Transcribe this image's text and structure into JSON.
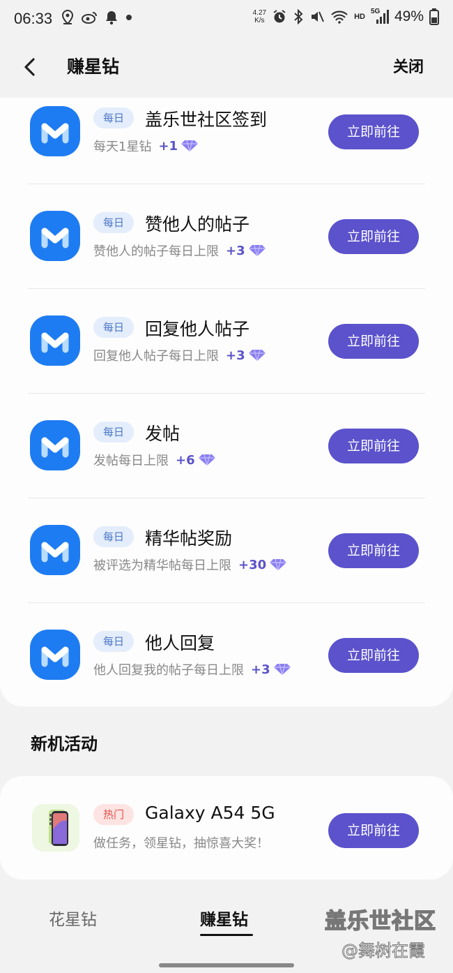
{
  "status_bar": {
    "time": "06:33",
    "net_speed_value": "4.27",
    "net_speed_unit": "K/s",
    "network_label": "HD",
    "signal_label": "5G",
    "battery": "49%",
    "left_icons": [
      "location-icon",
      "weibo-icon",
      "notification-bell-icon",
      "dot-icon"
    ],
    "right_icons": [
      "alarm-icon",
      "bluetooth-icon",
      "mute-icon",
      "wifi-icon",
      "signal-icon",
      "battery-icon"
    ]
  },
  "header": {
    "back_icon": "chevron-left-icon",
    "title": "赚星钻",
    "close_label": "关闭"
  },
  "tasks": [
    {
      "tag": "每日",
      "title": "盖乐世社区签到",
      "desc": "每天1星钻",
      "reward": "+1",
      "button": "立即前往"
    },
    {
      "tag": "每日",
      "title": "赞他人的帖子",
      "desc": "赞他人的帖子每日上限",
      "reward": "+3",
      "button": "立即前往"
    },
    {
      "tag": "每日",
      "title": "回复他人帖子",
      "desc": "回复他人帖子每日上限",
      "reward": "+3",
      "button": "立即前往"
    },
    {
      "tag": "每日",
      "title": "发帖",
      "desc": "发帖每日上限",
      "reward": "+6",
      "button": "立即前往"
    },
    {
      "tag": "每日",
      "title": "精华帖奖励",
      "desc": "被评选为精华帖每日上限",
      "reward": "+30",
      "button": "立即前往"
    },
    {
      "tag": "每日",
      "title": "他人回复",
      "desc": "他人回复我的帖子每日上限",
      "reward": "+3",
      "button": "立即前往"
    }
  ],
  "section": {
    "title": "新机活动"
  },
  "promo": {
    "tag": "热门",
    "title": "Galaxy A54 5G",
    "desc": "做任务，领星钻，抽惊喜大奖！",
    "button": "立即前往"
  },
  "bottom_tabs": {
    "tabs": [
      "花星钻",
      "赚星钻"
    ],
    "active": "赚星钻"
  },
  "watermark": {
    "line1": "盖乐世社区",
    "line2": "@舞树在霞"
  },
  "colors": {
    "accent": "#5b52cc",
    "app_icon_blue": "#1e7cf2",
    "daily_tag_bg": "#e4edfb",
    "hot_tag_bg": "#fde4e3",
    "gem_purple": "#8a7ff0"
  }
}
